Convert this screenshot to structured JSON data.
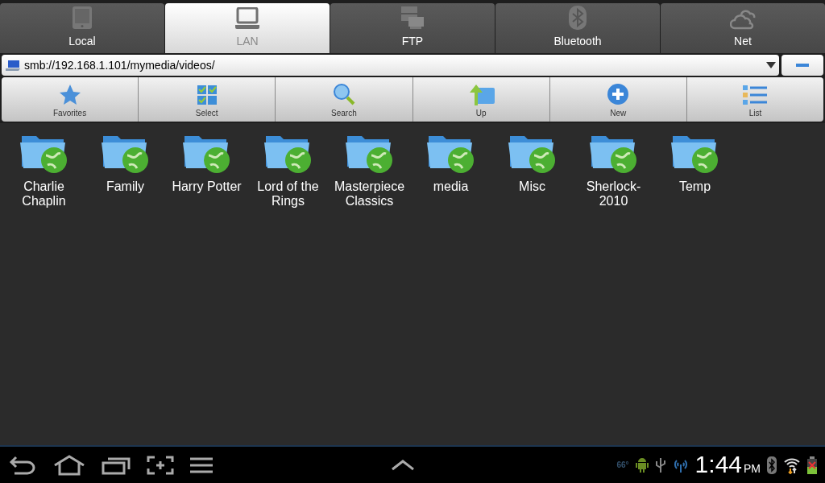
{
  "tabs": [
    {
      "label": "Local",
      "kind": "tablet",
      "selected": false
    },
    {
      "label": "LAN",
      "kind": "laptop",
      "selected": true
    },
    {
      "label": "FTP",
      "kind": "server",
      "selected": false
    },
    {
      "label": "Bluetooth",
      "kind": "bluetooth",
      "selected": false
    },
    {
      "label": "Net",
      "kind": "cloud",
      "selected": false
    }
  ],
  "path": {
    "value": "smb://192.168.1.101/mymedia/videos/"
  },
  "toolbar": [
    {
      "label": "Favorites",
      "kind": "star"
    },
    {
      "label": "Select",
      "kind": "select"
    },
    {
      "label": "Search",
      "kind": "search"
    },
    {
      "label": "Up",
      "kind": "up"
    },
    {
      "label": "New",
      "kind": "new"
    },
    {
      "label": "List",
      "kind": "list"
    }
  ],
  "folders": [
    {
      "name": "Charlie Chaplin"
    },
    {
      "name": "Family"
    },
    {
      "name": "Harry Potter"
    },
    {
      "name": "Lord of the Rings"
    },
    {
      "name": "Masterpiece Classics"
    },
    {
      "name": "media"
    },
    {
      "name": "Misc"
    },
    {
      "name": "Sherlock-2010"
    },
    {
      "name": "Temp"
    }
  ],
  "status_bar": {
    "temperature": "66°",
    "time": "1:44",
    "ampm": "PM"
  }
}
